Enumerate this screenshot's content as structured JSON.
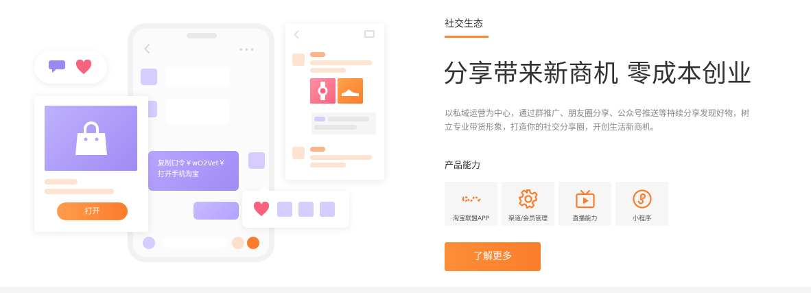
{
  "illustration": {
    "chat_message": [
      "复制口令￥wO2Vet￥",
      "打开手机淘宝"
    ],
    "open_button_label": "打开"
  },
  "section": {
    "eyebrow": "社交生态",
    "headline": "分享带来新商机 零成本创业",
    "description": "以私域运营为中心，通过群推广、朋友圈分享、公众号推送等持续分享发现好物，树立专业带货形象，打造你的社交分享圈，开创生活新商机。",
    "capabilities_label": "产品能力",
    "capabilities": [
      {
        "icon": "infinity-chain-icon",
        "label": "淘宝联盟APP"
      },
      {
        "icon": "gear-icon",
        "label": "渠道/会员管理"
      },
      {
        "icon": "tv-play-icon",
        "label": "直播能力"
      },
      {
        "icon": "mini-program-icon",
        "label": "小程序"
      }
    ],
    "cta_label": "了解更多"
  },
  "colors": {
    "accent": "#f7882f",
    "purple": "#a08bf3",
    "light_purple": "#d6ccff",
    "peach": "#fde3d2",
    "heart": "#f7637f"
  }
}
